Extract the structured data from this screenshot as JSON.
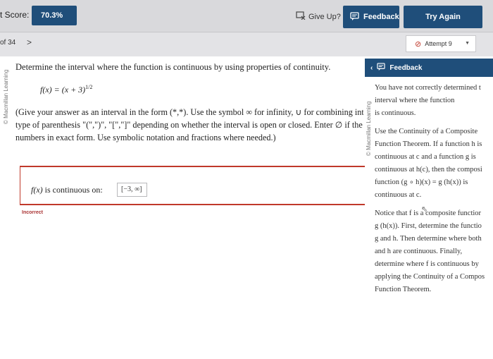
{
  "topbar": {
    "score_label": "t Score:",
    "score_value": "70.3%",
    "give_up_label": "Give Up?",
    "feedback_label": "Feedback",
    "try_again_label": "Try Again"
  },
  "nav": {
    "question_number": "of 34",
    "next_arrow": ">",
    "attempt_label": "Attempt 9"
  },
  "watermark": "© Macmillan Learning",
  "question": {
    "prompt": "Determine the interval where the function is continuous by using properties of continuity.",
    "function": "f(x) = (x + 3)",
    "exponent": "1/2",
    "instructions": [
      "(Give your answer as an interval in the form (*,*). Use the symbol ∞ for infinity, ∪ for combining inte",
      "type of parenthesis \"(\",\")\", \"[\",\"]\" depending on whether the interval is open or closed. Enter ∅ if the i",
      "numbers in exact form. Use symbolic notation and fractions where needed.)"
    ],
    "answer_label_func": "f(x)",
    "answer_label_rest": " is continuous on:",
    "answer_value": "[−3, ∞]",
    "status": "Incorrect"
  },
  "feedback": {
    "header": "Feedback",
    "para1": [
      "You have not correctly determined t",
      "interval where the function",
      "is continuous."
    ],
    "para2": [
      "Use the Continuity of a Composite",
      "Function Theorem. If a function h is",
      "continuous at c and a function g is",
      "continuous at h(c), then the composi",
      "function (g ∘ h)(x) = g (h(x)) is",
      "continuous at c."
    ],
    "para3": [
      "Notice that f is a composite functior",
      "g (h(x)). First, determine the functio",
      "g and h. Then determine where both",
      "and h are continuous. Finally,",
      "determine where f is continuous by",
      "applying the Continuity of a Compos",
      "Function Theorem."
    ]
  },
  "colors": {
    "primary": "#1f4e7a",
    "error": "#c0392b",
    "topbar_bg": "#d9d9dc"
  }
}
